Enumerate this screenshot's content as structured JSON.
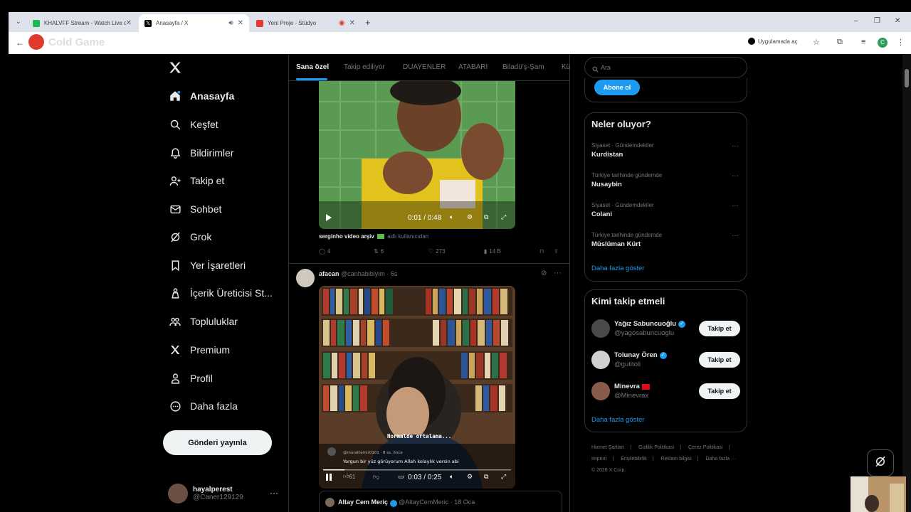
{
  "browser": {
    "tabs": [
      {
        "label": "KHALVFF Stream - Watch Live o",
        "fav_color": "#1db954"
      },
      {
        "label": "Anasayfa / X",
        "fav_color": "#000000"
      },
      {
        "label": "Yeni Proje - Stüdyo",
        "fav_color": "#e53935"
      }
    ],
    "new_tab": "+",
    "watermark": "Cold Game",
    "open_app": "Uygulamada aç",
    "profile_letter": "C"
  },
  "nav": {
    "items": [
      {
        "label": "Anasayfa",
        "icon": "home-icon"
      },
      {
        "label": "Keşfet",
        "icon": "search-icon"
      },
      {
        "label": "Bildirimler",
        "icon": "bell-icon"
      },
      {
        "label": "Takip et",
        "icon": "follow-icon"
      },
      {
        "label": "Sohbet",
        "icon": "mail-icon"
      },
      {
        "label": "Grok",
        "icon": "grok-icon"
      },
      {
        "label": "Yer İşaretleri",
        "icon": "bookmark-icon"
      },
      {
        "label": "İçerik Üreticisi St...",
        "icon": "creator-icon"
      },
      {
        "label": "Topluluklar",
        "icon": "communities-icon"
      },
      {
        "label": "Premium",
        "icon": "x-premium-icon"
      },
      {
        "label": "Profil",
        "icon": "profile-icon"
      },
      {
        "label": "Daha fazla",
        "icon": "more-circle-icon"
      }
    ],
    "post_button": "Gönderi yayınla",
    "me": {
      "name": "hayalperest",
      "handle": "@Caner129129"
    }
  },
  "timeline": {
    "tabs": [
      "Sana özel",
      "Takip ediliyor",
      "DUAYENLER",
      "ATABARI",
      "Biladü'ş-Şam",
      "Kü"
    ],
    "post1": {
      "video_time": "0:01 / 0:48",
      "caption_name": "serginho video arşiv",
      "caption_sub": "adlı kullanıcıdan",
      "replies": "4",
      "reposts": "6",
      "likes": "273",
      "views": "14 B"
    },
    "post2": {
      "name": "afacan",
      "handle": "@canhabiblyim",
      "time": "· 6s",
      "overlay_caption": "Normalde ortalama...",
      "comment_user": "@murattemir0101 · 8 ss. önce",
      "comment_text": "Yorgun bir yüz görüyorum Allah kolaylık versin abi",
      "comment_likes": "61",
      "video_time": "0:03 / 0:25"
    },
    "quote": {
      "name": "Altay Cem Meriç",
      "handle": "@AltayCemMeric",
      "time": "· 18 Oca"
    }
  },
  "right": {
    "search_placeholder": "Ara",
    "subscribe": "Abone ol",
    "trends_title": "Neler oluyor?",
    "trends": [
      {
        "context": "Siyaset · Gündemdekiler",
        "name": "Kurdistan"
      },
      {
        "context": "Türkiye tarihinde gündemde",
        "name": "Nusaybin"
      },
      {
        "context": "Siyaset · Gündemdekiler",
        "name": "Colani"
      },
      {
        "context": "Türkiye tarihinde gündemde",
        "name": "Müslüman Kürt"
      }
    ],
    "show_more": "Daha fazla göster",
    "who_title": "Kimi takip etmeli",
    "who": [
      {
        "name": "Yağız Sabuncuoğlu",
        "handle": "@yagosabuncuoglu",
        "verified": true,
        "color": "#4a4a4a"
      },
      {
        "name": "Tolunay Ören",
        "handle": "@gutitoli",
        "verified": true,
        "color": "#cfcfcf"
      },
      {
        "name": "Minevra",
        "handle": "@Minevrax",
        "verified": false,
        "color": "#8a5a4a"
      }
    ],
    "follow_label": "Takip et",
    "footer": [
      "Hizmet Şartları",
      "|",
      "Gizlilik Politikası",
      "|",
      "Çerez Politikası",
      "|",
      "Imprint",
      "|",
      "Erişilebilirlik",
      "|",
      "Reklam bilgisi",
      "|",
      "Daha fazla ···",
      "© 2026 X Corp."
    ]
  }
}
